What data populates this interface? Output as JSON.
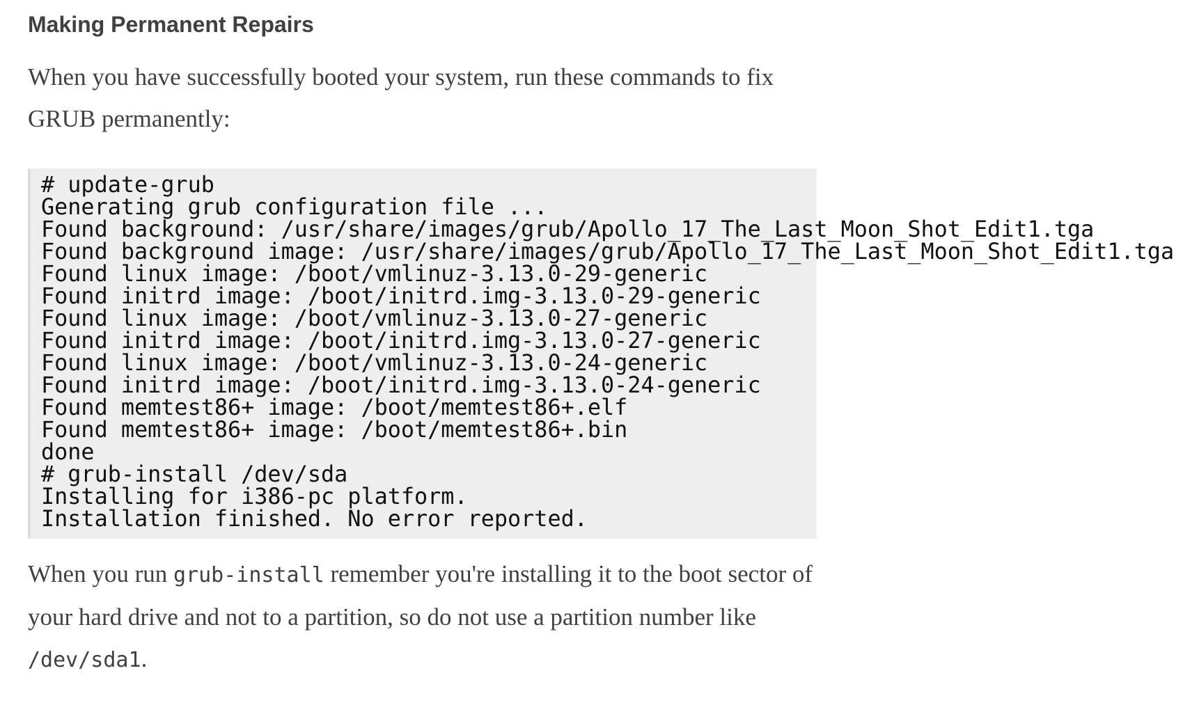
{
  "section": {
    "heading": "Making Permanent Repairs"
  },
  "intro": {
    "text": "When you have successfully booted your system, run these commands to fix GRUB permanently:"
  },
  "terminal": {
    "lines": [
      "# update-grub",
      "Generating grub configuration file ...",
      "Found background: /usr/share/images/grub/Apollo_17_The_Last_Moon_Shot_Edit1.tga",
      "Found background image: /usr/share/images/grub/Apollo_17_The_Last_Moon_Shot_Edit1.tga",
      "Found linux image: /boot/vmlinuz-3.13.0-29-generic",
      "Found initrd image: /boot/initrd.img-3.13.0-29-generic",
      "Found linux image: /boot/vmlinuz-3.13.0-27-generic",
      "Found initrd image: /boot/initrd.img-3.13.0-27-generic",
      "Found linux image: /boot/vmlinuz-3.13.0-24-generic",
      "Found initrd image: /boot/initrd.img-3.13.0-24-generic",
      "Found memtest86+ image: /boot/memtest86+.elf",
      "Found memtest86+ image: /boot/memtest86+.bin",
      "done",
      "# grub-install /dev/sda",
      "Installing for i386-pc platform.",
      "Installation finished. No error reported."
    ]
  },
  "outro": {
    "part1": "When you run ",
    "code1": "grub-install",
    "part2": " remember you're installing it to the boot sector of your hard drive and not to a partition, so do not use a partition number like ",
    "code2": "/dev/sda1",
    "part3": "."
  }
}
